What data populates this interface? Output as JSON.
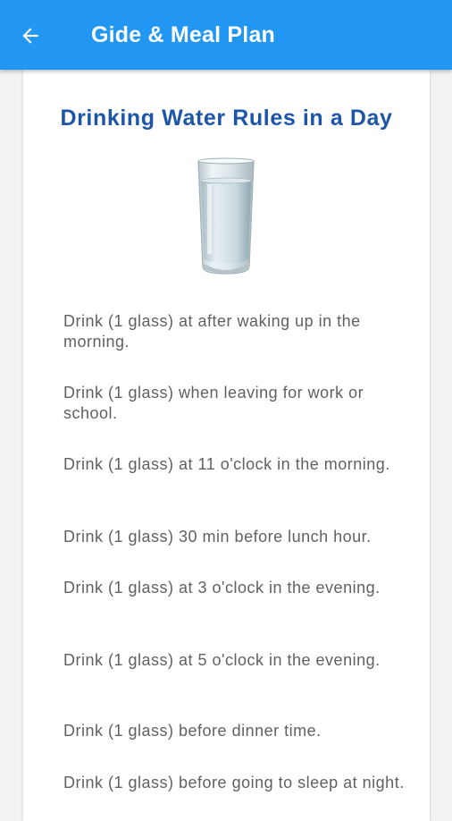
{
  "appbar": {
    "title": "Gide & Meal Plan",
    "color": "#2196f3"
  },
  "content": {
    "heading": "Drinking Water Rules in a Day",
    "heading_color": "#1d56a8",
    "image": "water-glass",
    "rules": [
      "Drink (1 glass) at after waking up in the morning.",
      "Drink (1 glass) when leaving for work or school.",
      "Drink (1 glass) at 11 o'clock in the morning.",
      "Drink (1 glass) 30 min before lunch hour.",
      "Drink (1 glass) at 3 o'clock in the evening.",
      "Drink (1 glass) at 5 o'clock in the evening.",
      "Drink (1 glass) before dinner time.",
      "Drink (1 glass) before going to sleep at night."
    ]
  }
}
